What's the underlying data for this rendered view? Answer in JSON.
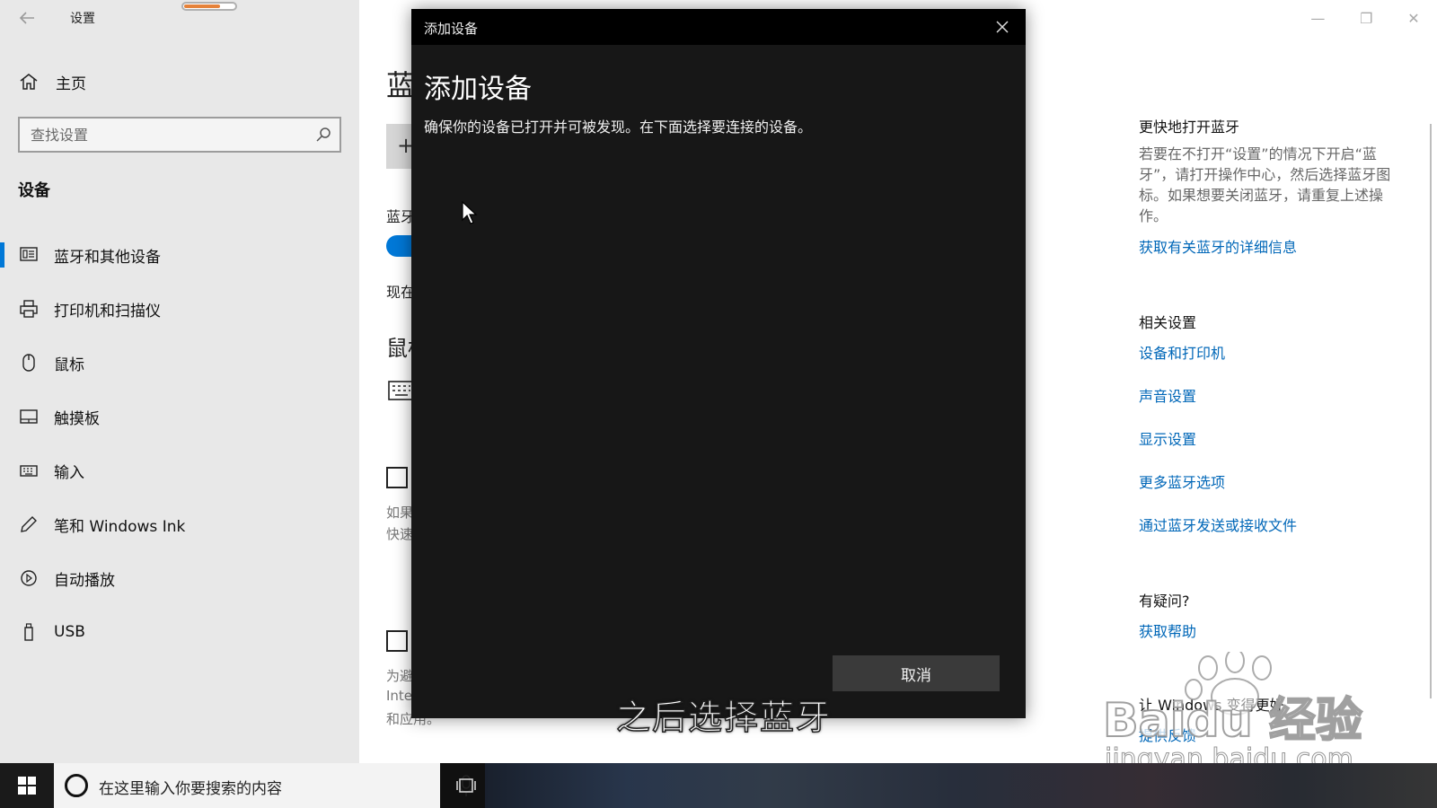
{
  "window": {
    "title": "设置",
    "controls": [
      "—",
      "❐",
      "✕"
    ]
  },
  "nav": {
    "home_label": "主页",
    "search_placeholder": "查找设置",
    "section_title": "设备",
    "items": [
      {
        "label": "蓝牙和其他设备",
        "icon": "bluetooth-devices-icon",
        "active": true
      },
      {
        "label": "打印机和扫描仪",
        "icon": "printer-icon",
        "active": false
      },
      {
        "label": "鼠标",
        "icon": "mouse-icon",
        "active": false
      },
      {
        "label": "触摸板",
        "icon": "touchpad-icon",
        "active": false
      },
      {
        "label": "输入",
        "icon": "keyboard-icon",
        "active": false
      },
      {
        "label": "笔和 Windows Ink",
        "icon": "pen-icon",
        "active": false
      },
      {
        "label": "自动播放",
        "icon": "autoplay-icon",
        "active": false
      },
      {
        "label": "USB",
        "icon": "usb-icon",
        "active": false
      }
    ]
  },
  "main": {
    "title_fragment": "蓝",
    "add_button": "+",
    "bt_label_fragment": "蓝牙",
    "now_fragment": "现在",
    "mouse_section_fragment": "鼠标",
    "note1": [
      "如果",
      "快速"
    ],
    "note2": [
      "为避",
      "Inte",
      "和应用。"
    ]
  },
  "dialog": {
    "titlebar": "添加设备",
    "heading": "添加设备",
    "description": "确保你的设备已打开并可被发现。在下面选择要连接的设备。",
    "cancel_label": "取消"
  },
  "right": {
    "quick_title": "更快地打开蓝牙",
    "quick_text": "若要在不打开“设置”的情况下开启“蓝牙”，请打开操作中心，然后选择蓝牙图标。如果想要关闭蓝牙，请重复上述操作。",
    "quick_link": "获取有关蓝牙的详细信息",
    "related_title": "相关设置",
    "related_links": [
      "设备和打印机",
      "声音设置",
      "显示设置",
      "更多蓝牙选项",
      "通过蓝牙发送或接收文件"
    ],
    "question_title": "有疑问?",
    "question_link": "获取帮助",
    "better_title": "让 Windows 变得更好",
    "better_link": "提供反馈"
  },
  "subtitle": "之后选择蓝牙",
  "watermark": {
    "brand": "Baidu 经验",
    "url": "jingyan.baidu.com"
  },
  "taskbar": {
    "search_text": "在这里输入你要搜索的内容"
  },
  "colors": {
    "accent": "#0078d7",
    "link": "#0067b8",
    "dialog_bg": "#171717",
    "nav_bg": "#e8e8e8"
  }
}
